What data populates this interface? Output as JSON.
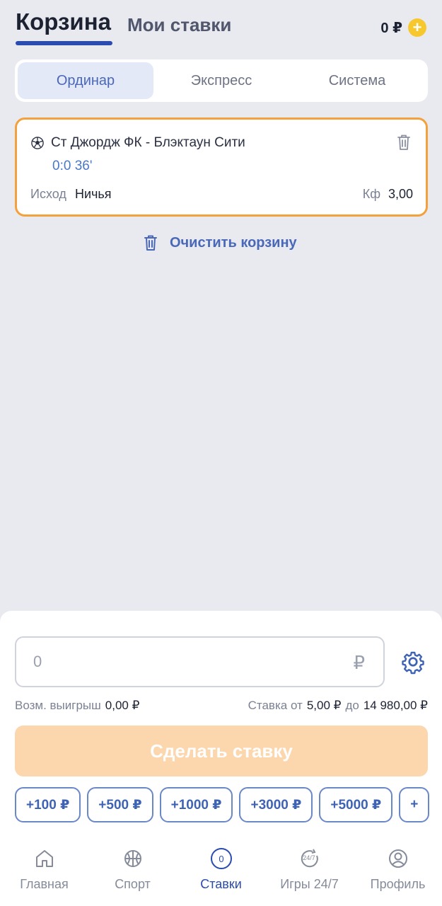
{
  "header": {
    "tab_cart": "Корзина",
    "tab_my_bets": "Мои ставки",
    "balance": "0 ₽",
    "plus": "+"
  },
  "bet_types": [
    "Ординар",
    "Экспресс",
    "Система"
  ],
  "bet_card": {
    "match": "Ст Джордж ФК - Блэктаун Сити",
    "score_time": "0:0 36'",
    "outcome_label": "Исход",
    "outcome_value": "Ничья",
    "coef_label": "Кф",
    "coef_value": "3,00"
  },
  "clear_cart": "Очистить корзину",
  "stake": {
    "placeholder": "0",
    "currency": "₽",
    "payout_label": "Возм. выигрыш",
    "payout_value": "0,00 ₽",
    "limit_from_label": "Ставка от",
    "limit_from_value": "5,00 ₽",
    "limit_to_label": "до",
    "limit_to_value": "14 980,00 ₽",
    "place_bet": "Сделать ставку"
  },
  "quick_amounts": [
    "+100 ₽",
    "+500 ₽",
    "+1000 ₽",
    "+3000 ₽",
    "+5000 ₽",
    "+"
  ],
  "nav": {
    "home": "Главная",
    "sport": "Спорт",
    "bets": "Ставки",
    "bets_count": "0",
    "games": "Игры 24/7",
    "games_badge": "24/7",
    "profile": "Профиль"
  },
  "colors": {
    "accent": "#2a4bb0",
    "card_border": "#f3a13c",
    "place_bet_disabled": "#fcd7ad",
    "link": "#4a68b8"
  }
}
